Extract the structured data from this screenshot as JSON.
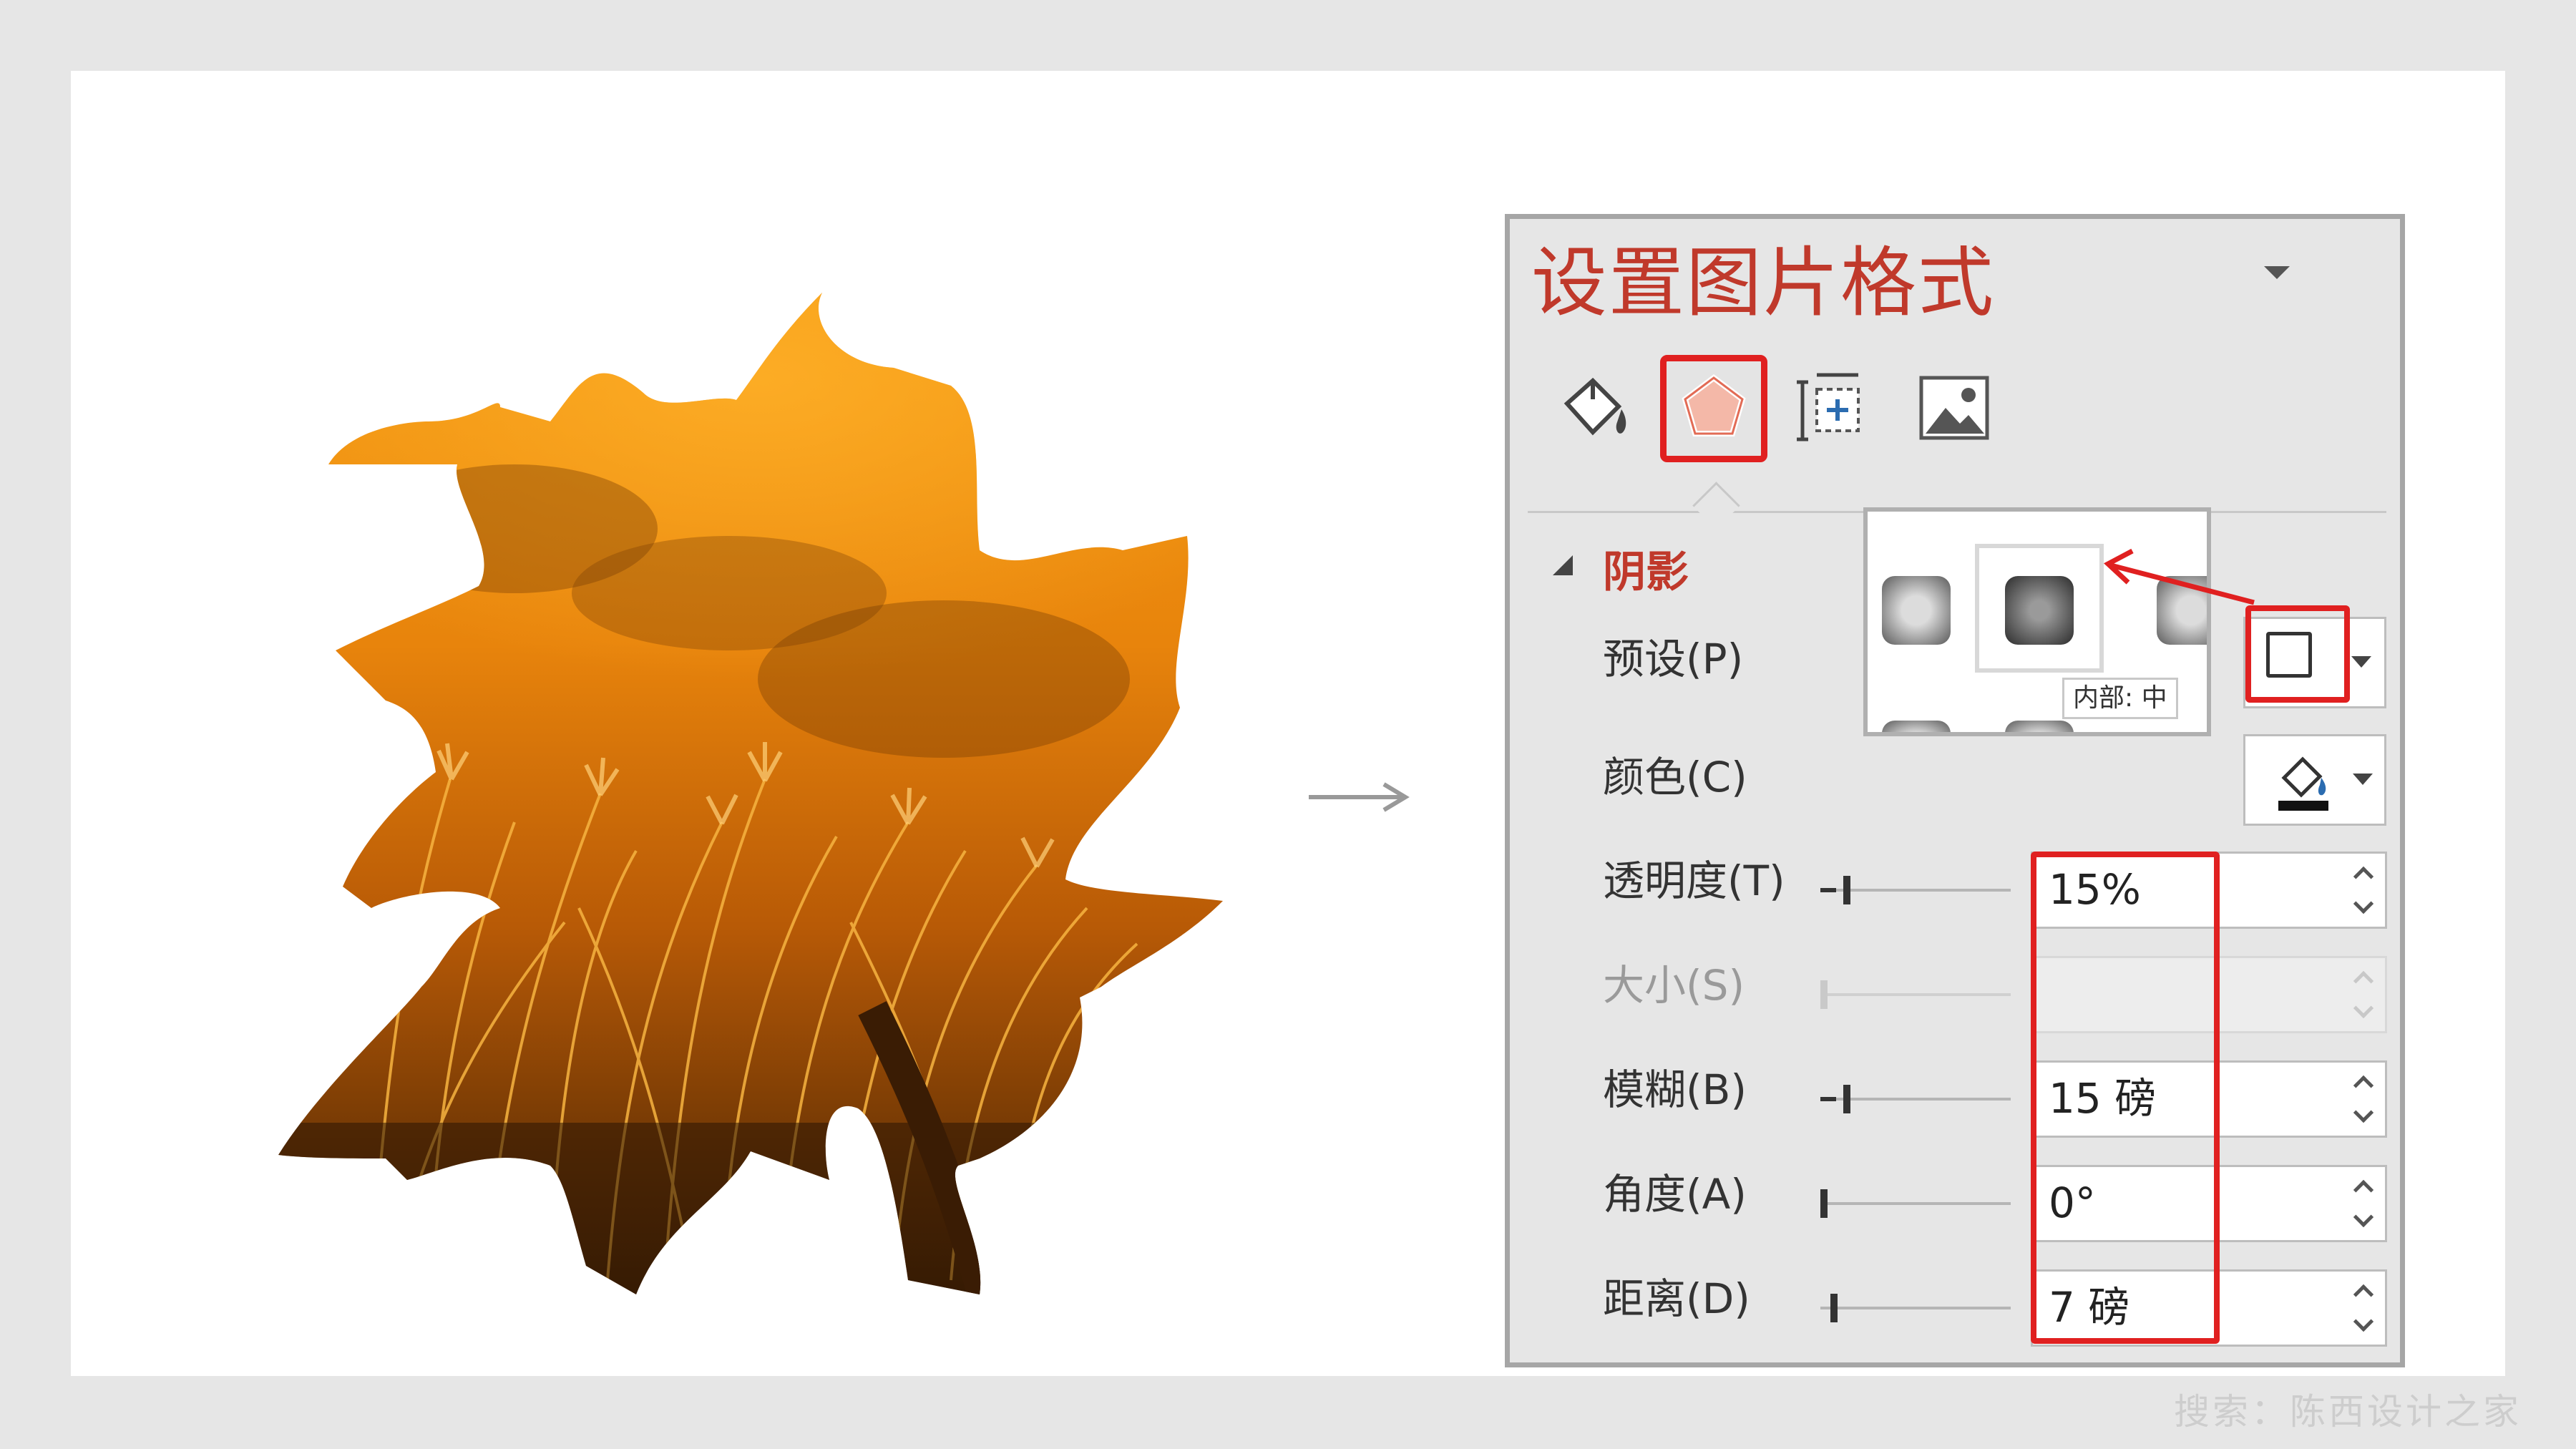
{
  "panel": {
    "title": "设置图片格式",
    "section_title": "阴影",
    "tabs": [
      "fill-line-icon",
      "effects-icon",
      "size-properties-icon",
      "picture-icon"
    ],
    "active_tab": "effects-icon"
  },
  "shadow": {
    "preset_label": "预设(P)",
    "color_label": "颜色(C)",
    "transparency_label": "透明度(T)",
    "transparency_value": "15%",
    "size_label": "大小(S)",
    "size_value": "",
    "blur_label": "模糊(B)",
    "blur_value": "15 磅",
    "angle_label": "角度(A)",
    "angle_value": "0°",
    "distance_label": "距离(D)",
    "distance_value": "7 磅"
  },
  "gallery": {
    "tooltip": "内部: 中"
  },
  "watermark": "搜索：陈西设计之家",
  "colors": {
    "accent_red": "#c0392b",
    "highlight_red": "#e02020",
    "leaf_orange": "#e8870c"
  }
}
